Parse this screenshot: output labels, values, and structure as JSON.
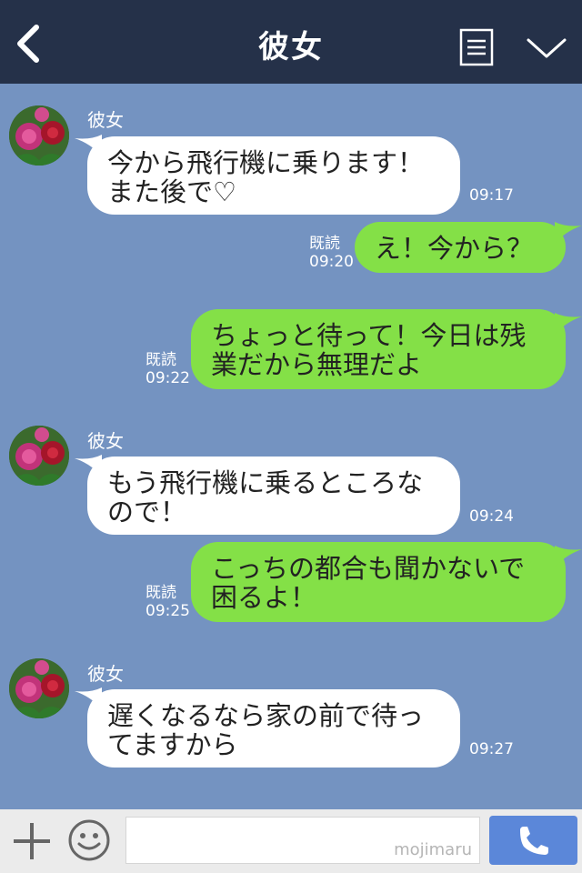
{
  "header": {
    "title": "彼女"
  },
  "messages": [
    {
      "dir": "in",
      "sender": "彼女",
      "lines": [
        "今から飛行機に乗ります！",
        "また後で♡"
      ],
      "time": "09:17"
    },
    {
      "dir": "out",
      "lines": [
        "え！今から？"
      ],
      "read": "既読",
      "time": "09:20"
    },
    {
      "dir": "out",
      "lines": [
        "ちょっと待って！今日は残",
        "業だから無理だよ"
      ],
      "read": "既読",
      "time": "09:22"
    },
    {
      "dir": "in",
      "sender": "彼女",
      "lines": [
        "もう飛行機に乗るところな",
        "ので！"
      ],
      "time": "09:24"
    },
    {
      "dir": "out",
      "lines": [
        "こっちの都合も聞かないで",
        "困るよ！"
      ],
      "read": "既読",
      "time": "09:25"
    },
    {
      "dir": "in",
      "sender": "彼女",
      "lines": [
        "遅くなるなら家の前で待っ",
        "てますから"
      ],
      "time": "09:27"
    }
  ],
  "footer": {
    "watermark": "mojimaru"
  },
  "colors": {
    "header": "#253149",
    "chat_bg": "#7493c1",
    "outgoing": "#84e047",
    "incoming": "#ffffff",
    "call_button": "#5b87d9"
  },
  "icons": [
    "back-chevron-icon",
    "menu-icon",
    "chevron-down-icon",
    "plus-icon",
    "emoji-icon",
    "phone-icon"
  ]
}
